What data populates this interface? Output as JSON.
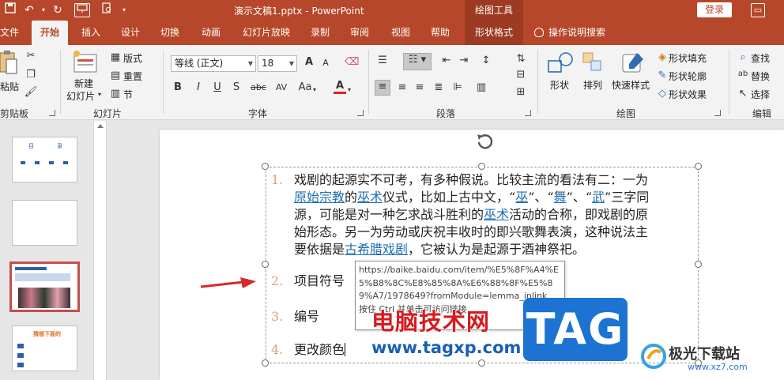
{
  "titlebar": {
    "doc_title": "演示文稿1.pptx  -  PowerPoint",
    "tools_title": "绘图工具",
    "login": "登录",
    "restore_icon": "restore-icon",
    "accent": "#b7472a"
  },
  "tabs": {
    "file": "文件",
    "home": "开始",
    "insert": "插入",
    "design": "设计",
    "transitions": "切换",
    "animations": "动画",
    "slideshow": "幻灯片放映",
    "record": "录制",
    "review": "审阅",
    "view": "视图",
    "help": "帮助",
    "shape_format": "形状格式",
    "tell_me": "操作说明搜索"
  },
  "ribbon": {
    "clipboard": {
      "paste": "粘贴",
      "label": "剪贴板"
    },
    "slides": {
      "new_slide_line1": "新建",
      "new_slide_line2": "幻灯片",
      "layout": "版式",
      "reset": "重置",
      "section": "节",
      "label": "幻灯片"
    },
    "font": {
      "font_name": "等线 (正文)",
      "font_size": "18",
      "bold": "B",
      "italic": "I",
      "underline": "U",
      "shadow": "S",
      "strike": "abc",
      "spacing": "AV",
      "case": "Aa",
      "font_color": "A",
      "grow": "A",
      "shrink": "A",
      "label": "字体"
    },
    "paragraph": {
      "label": "段落"
    },
    "drawing": {
      "shapes": "形状",
      "arrange": "排列",
      "quick_styles": "快速样式",
      "fill": "形状填充",
      "outline": "形状轮廓",
      "effects": "形状效果",
      "label": "绘图"
    },
    "editing": {
      "find": "查找",
      "replace": "替换",
      "select": "选择",
      "label": "编辑"
    }
  },
  "slide": {
    "p1_num": "1.",
    "p1_line1": "戏剧的起源实不可考，有多种假说。比较主流的看法有二：一为",
    "p1_line2": {
      "link_a": "原始宗教",
      "t1": "的",
      "link_b": "巫术",
      "t2": "仪式，比如上古中文，“",
      "link_c": "巫",
      "t3": "”、“",
      "link_d": "舞",
      "t4": "”、“",
      "link_e": "武",
      "t5": "”三字同"
    },
    "p1_line3": {
      "t1": "源，可能是对一种乞求战斗胜利的",
      "link": "巫术",
      "t2": "活动的合称，即戏剧的原"
    },
    "p1_line4": "始形态。另一为劳动或庆祝丰收时的即兴歌舞表演，这种说法主",
    "p1_line5": {
      "t1": "要依据是",
      "link": "古希腊戏剧",
      "t2": "，它被认为是起源于酒神祭祀。"
    },
    "p2_num": "2.",
    "p2_text": "项目符号",
    "p3_num": "3.",
    "p3_text": "编号",
    "p4_num": "4.",
    "p4_text": "更改颜色"
  },
  "tooltip": {
    "url": "https://baike.baidu.com/item/%E5%8F%A4%E5%B8%8C%E8%85%8A%E6%88%8F%E5%89%A7/1978649?fromModule=lemma_inlink",
    "hint": "按住 Ctrl 并单击可访问链接"
  },
  "watermarks": {
    "site_name": "电脑技术网",
    "site_url": "www.tagxp.com",
    "tag": "TAG",
    "brand_name": "极光下载站",
    "brand_url": "www.xz7.com"
  },
  "thumbnails": {
    "t1_title_a": "目",
    "t1_title_b": "录",
    "t4_title": "猜想下面的"
  }
}
